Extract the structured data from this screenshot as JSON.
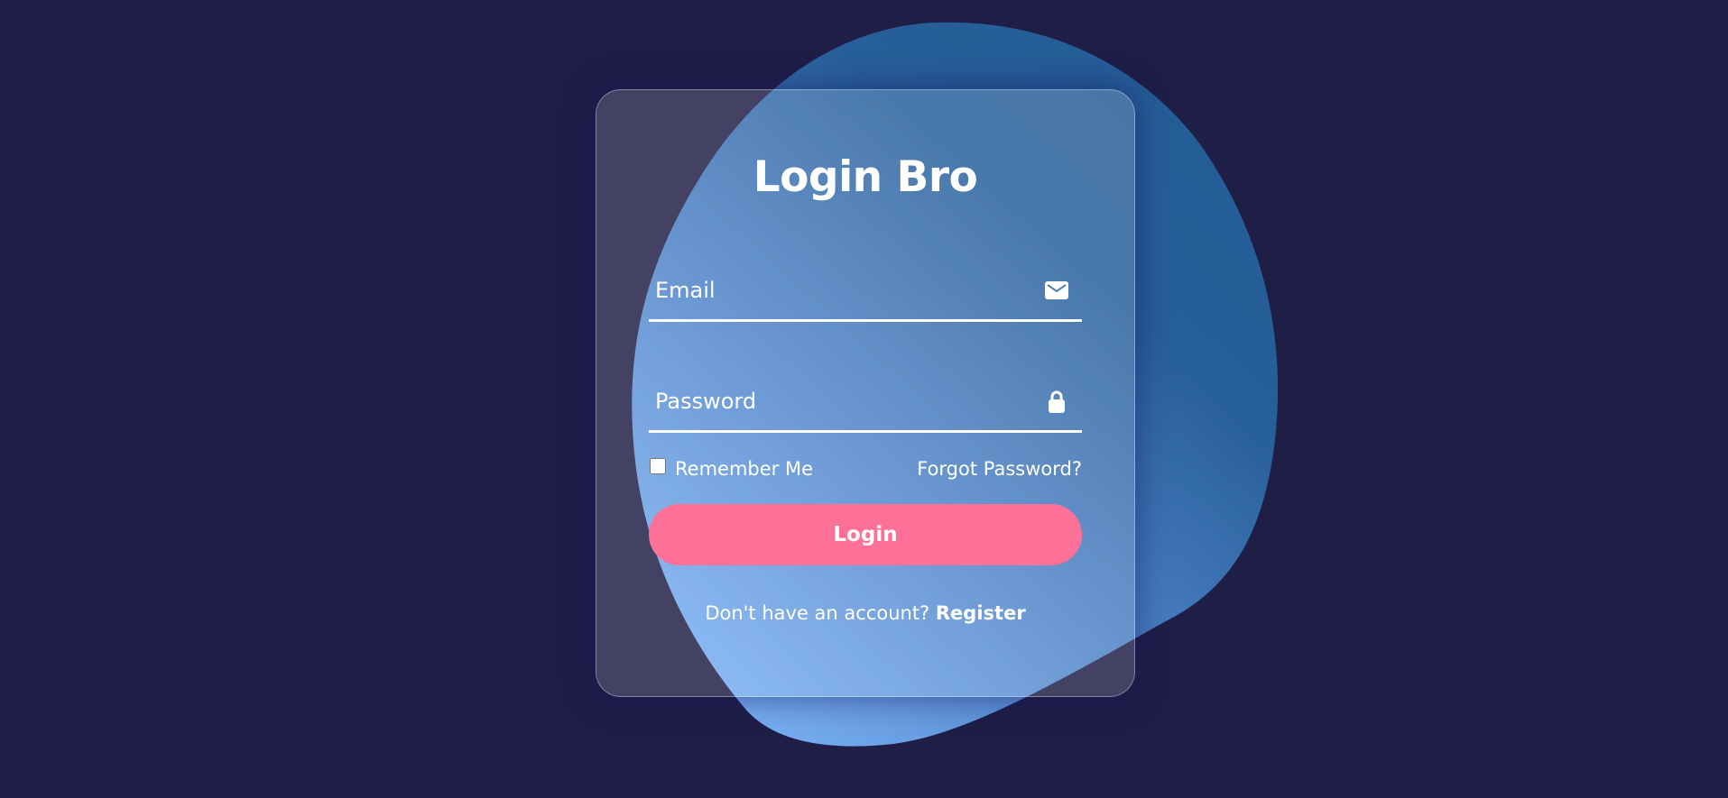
{
  "colors": {
    "background": "#1f1e47",
    "blob_light": "#75aef5",
    "blob_dark": "#25609a",
    "button": "#fd7097",
    "text": "#ffffff"
  },
  "login": {
    "title": "Login Bro",
    "email_placeholder": "Email",
    "email_icon": "mail-icon",
    "password_placeholder": "Password",
    "password_icon": "lock-icon",
    "remember_label": "Remember Me",
    "forgot_label": "Forgot Password?",
    "button_label": "Login",
    "register_prompt": "Don't have an account?",
    "register_label": "Register"
  }
}
